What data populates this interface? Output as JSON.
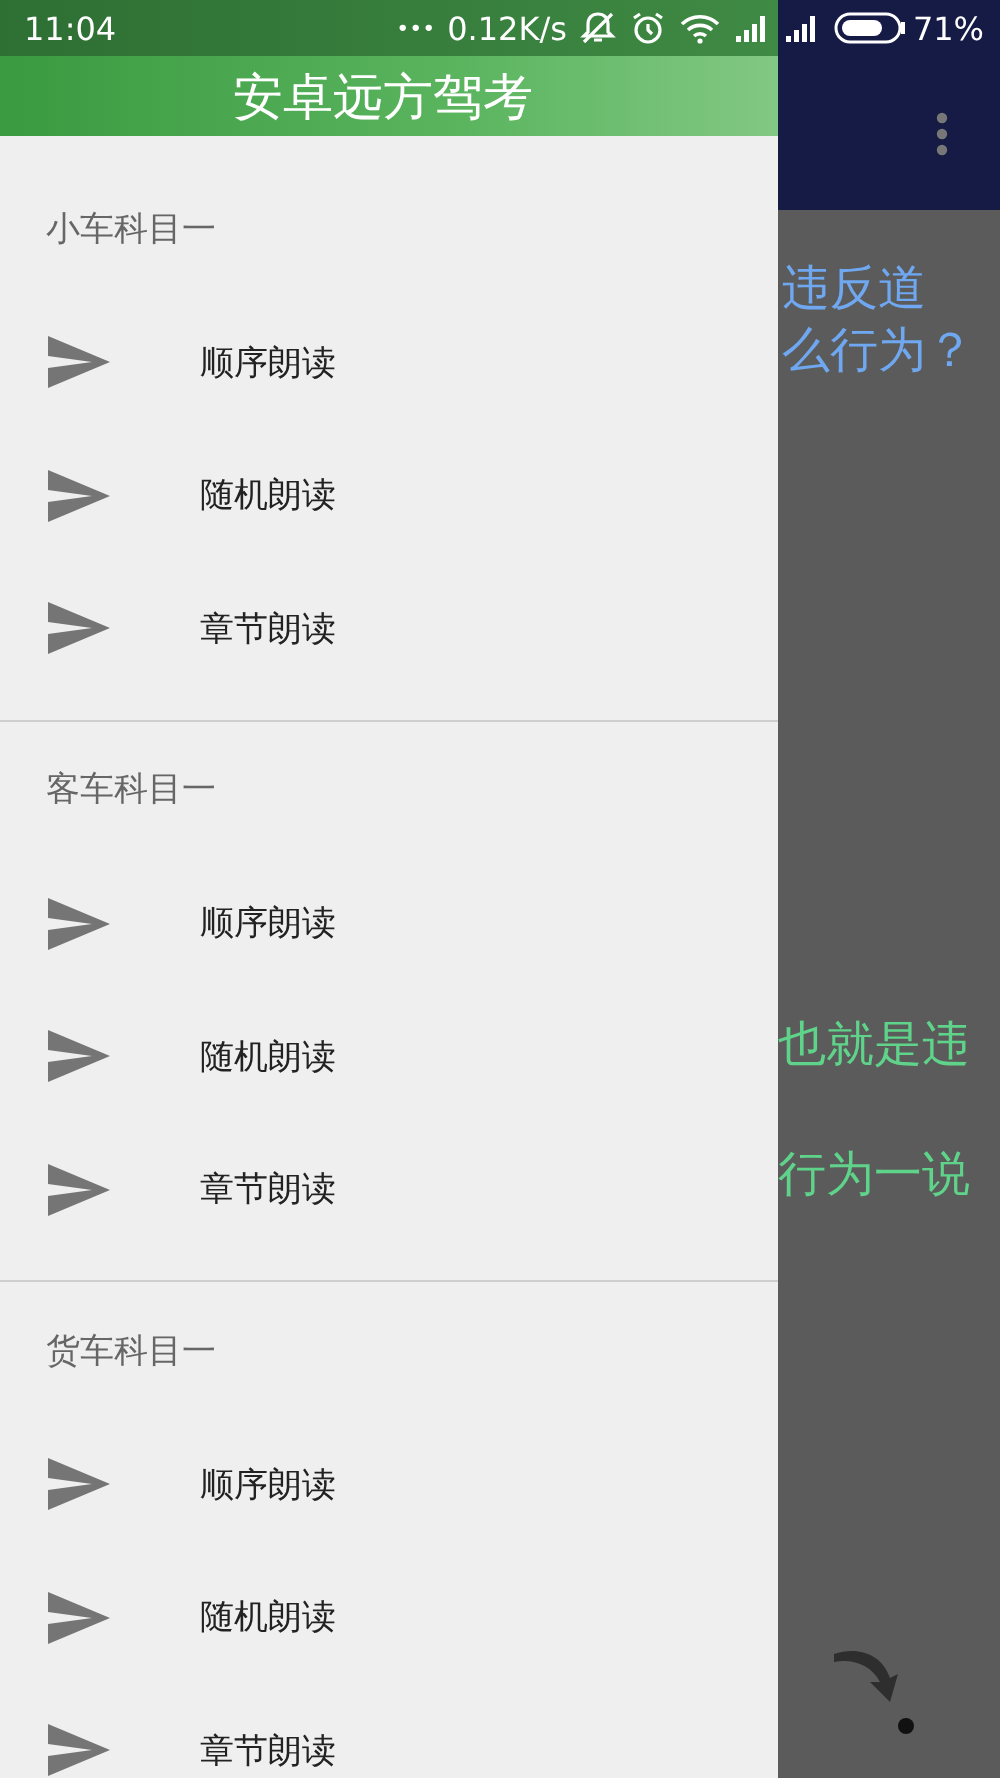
{
  "status_bar": {
    "time": "11:04",
    "dots": "•••",
    "speed": "0.12K/s",
    "battery_percent": "71%"
  },
  "drawer": {
    "title": "安卓远方驾考",
    "sections": [
      {
        "title": "小车科目一",
        "items": [
          {
            "label": "顺序朗读"
          },
          {
            "label": "随机朗读"
          },
          {
            "label": "章节朗读"
          }
        ]
      },
      {
        "title": "客车科目一",
        "items": [
          {
            "label": "顺序朗读"
          },
          {
            "label": "随机朗读"
          },
          {
            "label": "章节朗读"
          }
        ]
      },
      {
        "title": "货车科目一",
        "items": [
          {
            "label": "顺序朗读"
          },
          {
            "label": "随机朗读"
          },
          {
            "label": "章节朗读"
          }
        ]
      }
    ]
  },
  "background": {
    "question_lines": [
      "违反道",
      "么行为？"
    ],
    "answer_lines": [
      "也就是违",
      "行为一说"
    ]
  }
}
